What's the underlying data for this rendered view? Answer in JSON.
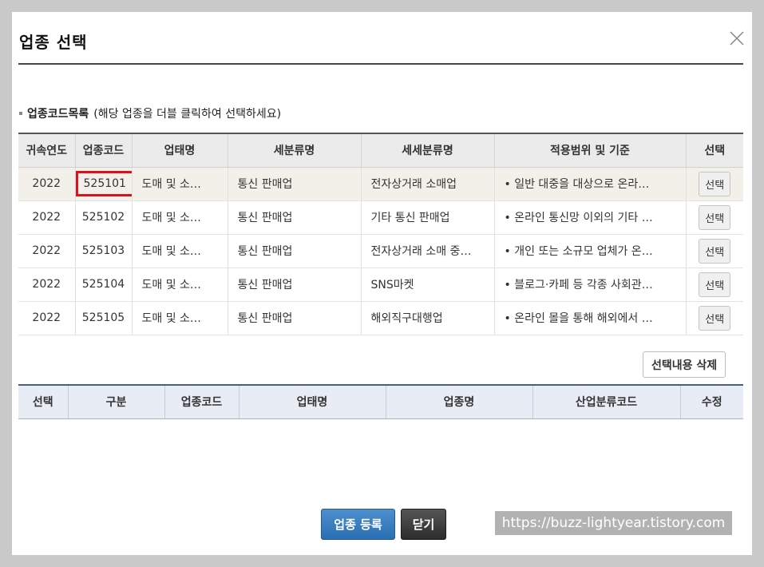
{
  "dialog": {
    "title": "업종 선택",
    "section_title": "업종코드목록",
    "section_hint": "(해당 업종을 더블 클릭하여 선택하세요)"
  },
  "top_table": {
    "headers": [
      "귀속연도",
      "업종코드",
      "업태명",
      "세분류명",
      "세세분류명",
      "적용범위 및 기준",
      "선택"
    ],
    "rows": [
      {
        "year": "2022",
        "code": "525101",
        "type": "도매 및 소…",
        "sub": "통신 판매업",
        "subsub": "전자상거래 소매업",
        "scope": "• 일반 대중을 대상으로 온라…",
        "btn": "선택"
      },
      {
        "year": "2022",
        "code": "525102",
        "type": "도매 및 소…",
        "sub": "통신 판매업",
        "subsub": "기타 통신 판매업",
        "scope": "• 온라인 통신망 이외의 기타 …",
        "btn": "선택"
      },
      {
        "year": "2022",
        "code": "525103",
        "type": "도매 및 소…",
        "sub": "통신 판매업",
        "subsub": "전자상거래 소매 중…",
        "scope": "• 개인 또는 소규모 업체가 온…",
        "btn": "선택"
      },
      {
        "year": "2022",
        "code": "525104",
        "type": "도매 및 소…",
        "sub": "통신 판매업",
        "subsub": "SNS마켓",
        "scope": "• 블로그·카페 등 각종 사회관…",
        "btn": "선택"
      },
      {
        "year": "2022",
        "code": "525105",
        "type": "도매 및 소…",
        "sub": "통신 판매업",
        "subsub": "해외직구대행업",
        "scope": "•  온라인 몰을 통해 해외에서 …",
        "btn": "선택"
      }
    ]
  },
  "delete_button": "선택내용 삭제",
  "bottom_table": {
    "headers": [
      "선택",
      "구분",
      "업종코드",
      "업태명",
      "업종명",
      "산업분류코드",
      "수정"
    ]
  },
  "footer": {
    "register_button": "업종 등록",
    "close_button": "닫기"
  },
  "watermark": "https://buzz-lightyear.tistory.com",
  "colors": {
    "highlight_border": "#e0101a",
    "primary_button": "#2a6fb2",
    "dark_button": "#2d2d2d"
  }
}
